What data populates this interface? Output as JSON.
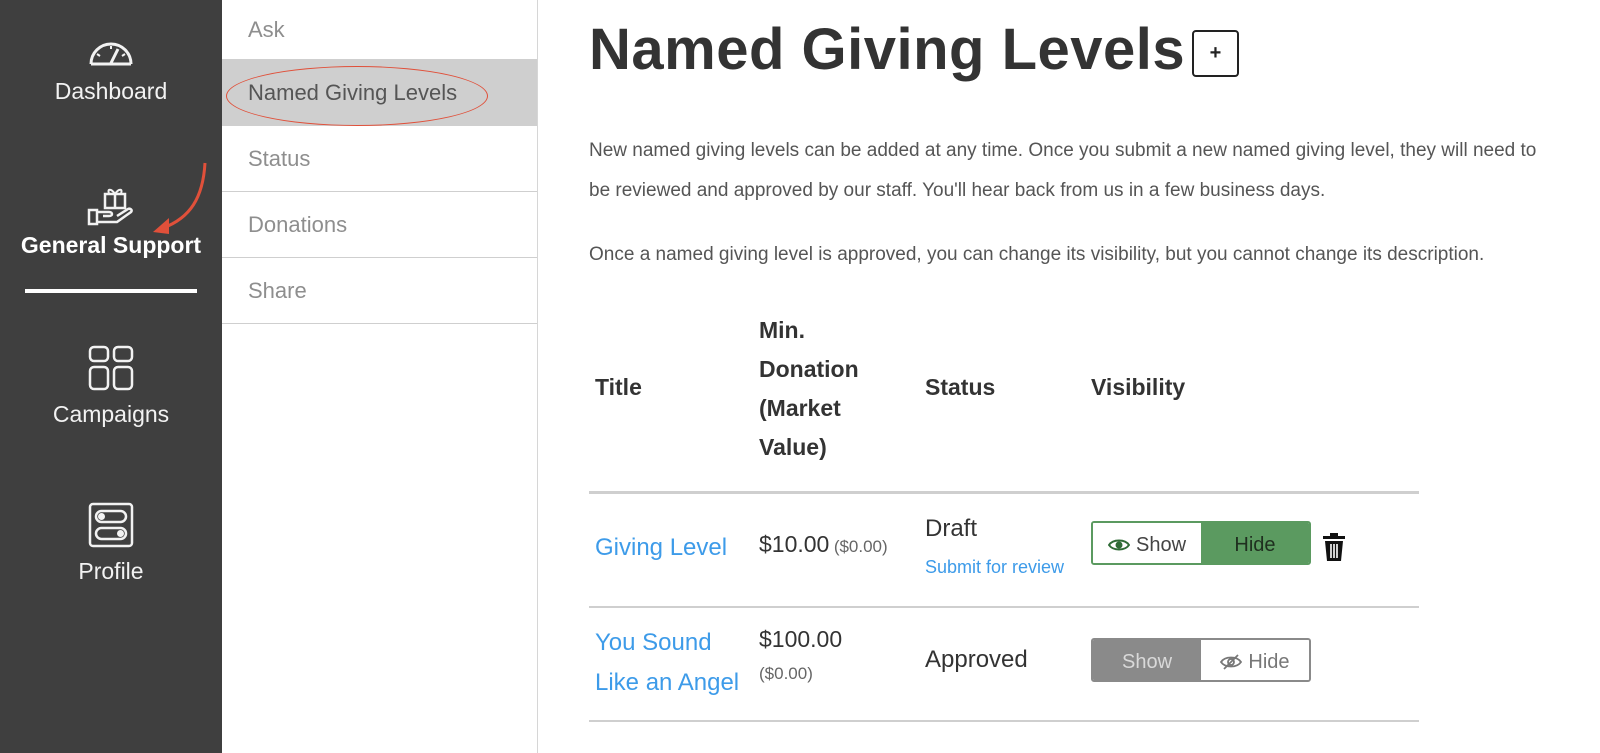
{
  "nav": {
    "items": [
      {
        "label": "Dashboard",
        "icon": "gauge-icon"
      },
      {
        "label": "General Support",
        "icon": "gift-hand-icon",
        "active": true
      },
      {
        "label": "Campaigns",
        "icon": "grid-icon"
      },
      {
        "label": "Profile",
        "icon": "toggles-icon"
      }
    ]
  },
  "subnav": {
    "items": [
      {
        "label": "Ask"
      },
      {
        "label": "Named Giving Levels",
        "active": true
      },
      {
        "label": "Status"
      },
      {
        "label": "Donations"
      },
      {
        "label": "Share"
      }
    ]
  },
  "main": {
    "title": "Named Giving Levels",
    "add_label": "+",
    "para1_line1": "New named giving levels can be added at any time. Once you submit a new named giving level, they will need to",
    "para1_line2": "be reviewed and approved by our staff. You'll hear back from us in a few business days.",
    "para2": "Once a named giving level is approved, you can change its visibility, but you cannot change its description."
  },
  "table": {
    "headers": {
      "title": "Title",
      "min_1": "Min.",
      "min_2": "Donation",
      "min_3": "(Market",
      "min_4": "Value)",
      "status": "Status",
      "visibility": "Visibility"
    },
    "rows": [
      {
        "title": "Giving Level",
        "amount": "$10.00",
        "market": "($0.00)",
        "status": "Draft",
        "action": "Submit for review",
        "show": "Show",
        "hide": "Hide"
      },
      {
        "title_1": "You Sound",
        "title_2": "Like an Angel",
        "amount": "$100.00",
        "market": "($0.00)",
        "status": "Approved",
        "show": "Show",
        "hide": "Hide"
      }
    ]
  },
  "colors": {
    "nav_bg": "#3f3f3f",
    "link": "#3d9be9",
    "green": "#5b9a60",
    "annotation": "#e0503a"
  }
}
